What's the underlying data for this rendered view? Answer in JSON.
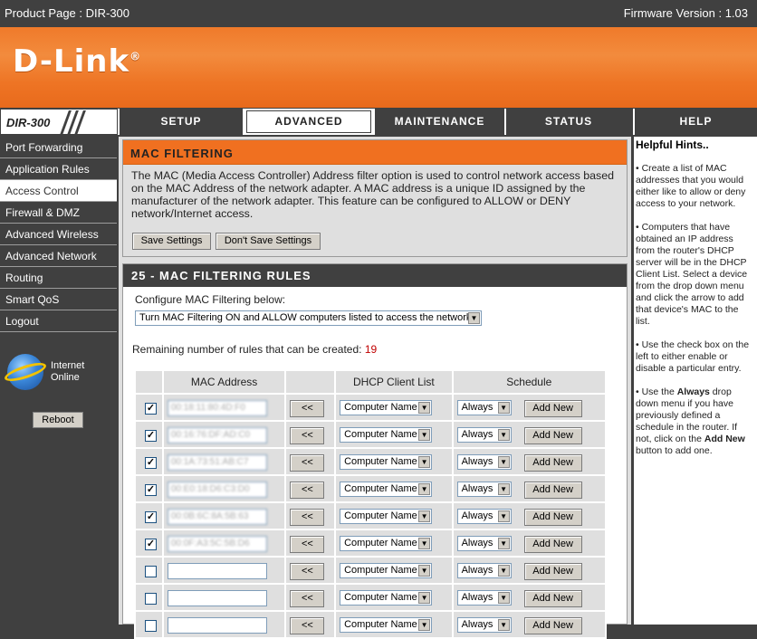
{
  "topbar": {
    "product": "Product Page :  DIR-300",
    "firmware": "Firmware Version : 1.03"
  },
  "brand": {
    "logo": "D-Link",
    "model": "DIR-300"
  },
  "tabs": [
    {
      "label": "SETUP"
    },
    {
      "label": "ADVANCED"
    },
    {
      "label": "MAINTENANCE"
    },
    {
      "label": "STATUS"
    },
    {
      "label": "HELP"
    }
  ],
  "sidebar": {
    "items": [
      {
        "label": "Port Forwarding"
      },
      {
        "label": "Application Rules"
      },
      {
        "label": "Access Control"
      },
      {
        "label": "Firewall & DMZ"
      },
      {
        "label": "Advanced Wireless"
      },
      {
        "label": "Advanced Network"
      },
      {
        "label": "Routing"
      },
      {
        "label": "Smart QoS"
      },
      {
        "label": "Logout"
      }
    ],
    "internet_line1": "Internet",
    "internet_line2": "Online",
    "reboot": "Reboot"
  },
  "mac_filtering": {
    "title": "MAC FILTERING",
    "description": "The MAC (Media Access Controller) Address filter option is used to control network access based on the MAC Address of the network adapter. A MAC address is a unique ID assigned by the manufacturer of the network adapter. This feature can be configured to ALLOW or DENY network/Internet access.",
    "save": "Save Settings",
    "dont_save": "Don't Save Settings"
  },
  "rules": {
    "title": "25 - MAC FILTERING RULES",
    "configure_label": "Configure MAC Filtering below:",
    "mode_selected": "Turn MAC Filtering ON and ALLOW computers listed to access the network",
    "remaining_label": "Remaining number of rules that can be created:",
    "remaining_count": "19",
    "columns": {
      "mac": "MAC Address",
      "dhcp": "DHCP Client List",
      "schedule": "Schedule"
    },
    "copy_button": "<<",
    "computer_name": "Computer Name",
    "schedule_value": "Always",
    "add_new": "Add New",
    "rows": [
      {
        "checked": true,
        "mac": "00:18:11:80:4D:F0"
      },
      {
        "checked": true,
        "mac": "00:16:76:DF:AD:C0"
      },
      {
        "checked": true,
        "mac": "00:1A:73:51:AB:C7"
      },
      {
        "checked": true,
        "mac": "00:E0:18:D6:C3:D0"
      },
      {
        "checked": true,
        "mac": "00:0B:6C:8A:5B:63"
      },
      {
        "checked": true,
        "mac": "00:0F:A3:5C:5B:D6"
      },
      {
        "checked": false,
        "mac": ""
      },
      {
        "checked": false,
        "mac": ""
      },
      {
        "checked": false,
        "mac": ""
      }
    ]
  },
  "help": {
    "title": "Helpful Hints..",
    "hint1": "• Create a list of MAC addresses that you would either like to allow or deny access to your network.",
    "hint2": "• Computers that have obtained an IP address from the router's DHCP server will be in the DHCP Client List. Select a device from the drop down menu and click the arrow to add that device's MAC to the list.",
    "hint3": "• Use the check box on the left to either enable or disable a particular entry.",
    "hint4_pre": "• Use the ",
    "hint4_bold1": "Always",
    "hint4_mid": " drop down menu if you have previously defined a schedule in the router. If not, click on the ",
    "hint4_bold2": "Add New",
    "hint4_post": " button to add one."
  },
  "colors": {
    "accent": "#f07020",
    "dark": "#404040",
    "remaining": "#c00000"
  }
}
